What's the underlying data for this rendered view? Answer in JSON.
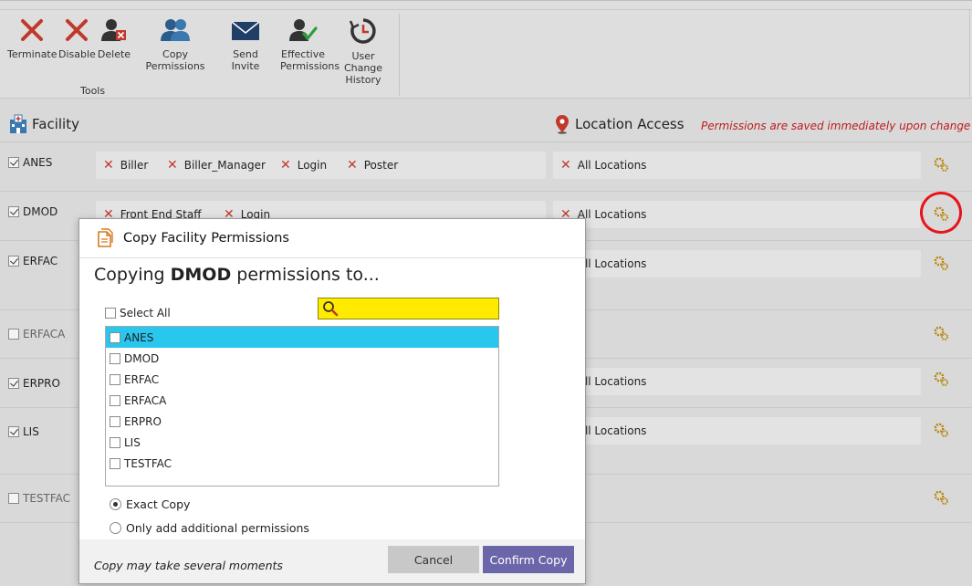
{
  "ribbon": {
    "buttons": [
      {
        "label": "Terminate",
        "icon": "red-x-icon"
      },
      {
        "label": "Disable",
        "icon": "red-x-icon"
      },
      {
        "label": "Delete",
        "icon": "delete-user-icon"
      },
      {
        "label": "Copy Permissions",
        "icon": "copy-users-icon"
      },
      {
        "label": "Send Invite",
        "icon": "envelope-icon"
      },
      {
        "label": "Effective Permissions",
        "icon": "user-check-icon"
      },
      {
        "label": "User Change History",
        "icon": "history-clock-icon"
      }
    ],
    "group_label": "Tools"
  },
  "header": {
    "facility": "Facility",
    "location_access": "Location Access",
    "note": "Permissions are saved immediately upon change"
  },
  "rows": [
    {
      "facility": "ANES",
      "checked": true,
      "roles": [
        "Biller",
        "Biller_Manager",
        "Login",
        "Poster"
      ],
      "location": "All Locations"
    },
    {
      "facility": "DMOD",
      "checked": true,
      "roles": [
        "Front End Staff",
        "Login"
      ],
      "location": "All Locations"
    },
    {
      "facility": "ERFAC",
      "checked": true,
      "roles": [],
      "location": "All Locations"
    },
    {
      "facility": "ERFACA",
      "checked": false,
      "roles": [],
      "location": ""
    },
    {
      "facility": "ERPRO",
      "checked": true,
      "roles": [],
      "location": "All Locations"
    },
    {
      "facility": "LIS",
      "checked": true,
      "roles": [],
      "location": "All Locations"
    },
    {
      "facility": "TESTFAC",
      "checked": false,
      "roles": [],
      "location": ""
    }
  ],
  "modal": {
    "title": "Copy Facility Permissions",
    "copying_prefix": "Copying ",
    "source_facility": "DMOD",
    "copying_suffix": " permissions to...",
    "select_all": "Select All",
    "search_value": "",
    "items": [
      {
        "label": "ANES",
        "selected": true
      },
      {
        "label": "DMOD",
        "selected": false
      },
      {
        "label": "ERFAC",
        "selected": false
      },
      {
        "label": "ERFACA",
        "selected": false
      },
      {
        "label": "ERPRO",
        "selected": false
      },
      {
        "label": "LIS",
        "selected": false
      },
      {
        "label": "TESTFAC",
        "selected": false
      }
    ],
    "option_exact": "Exact Copy",
    "option_additional": "Only add additional permissions",
    "selected_option": "exact",
    "footer_note": "Copy may take several moments",
    "cancel": "Cancel",
    "confirm": "Confirm Copy"
  },
  "colors": {
    "accent": "#6b66aa",
    "selected_row": "#29c6ee",
    "search_bg": "#ffea00",
    "note_red": "#c11b1b",
    "annotation_circle": "#e8141c"
  }
}
